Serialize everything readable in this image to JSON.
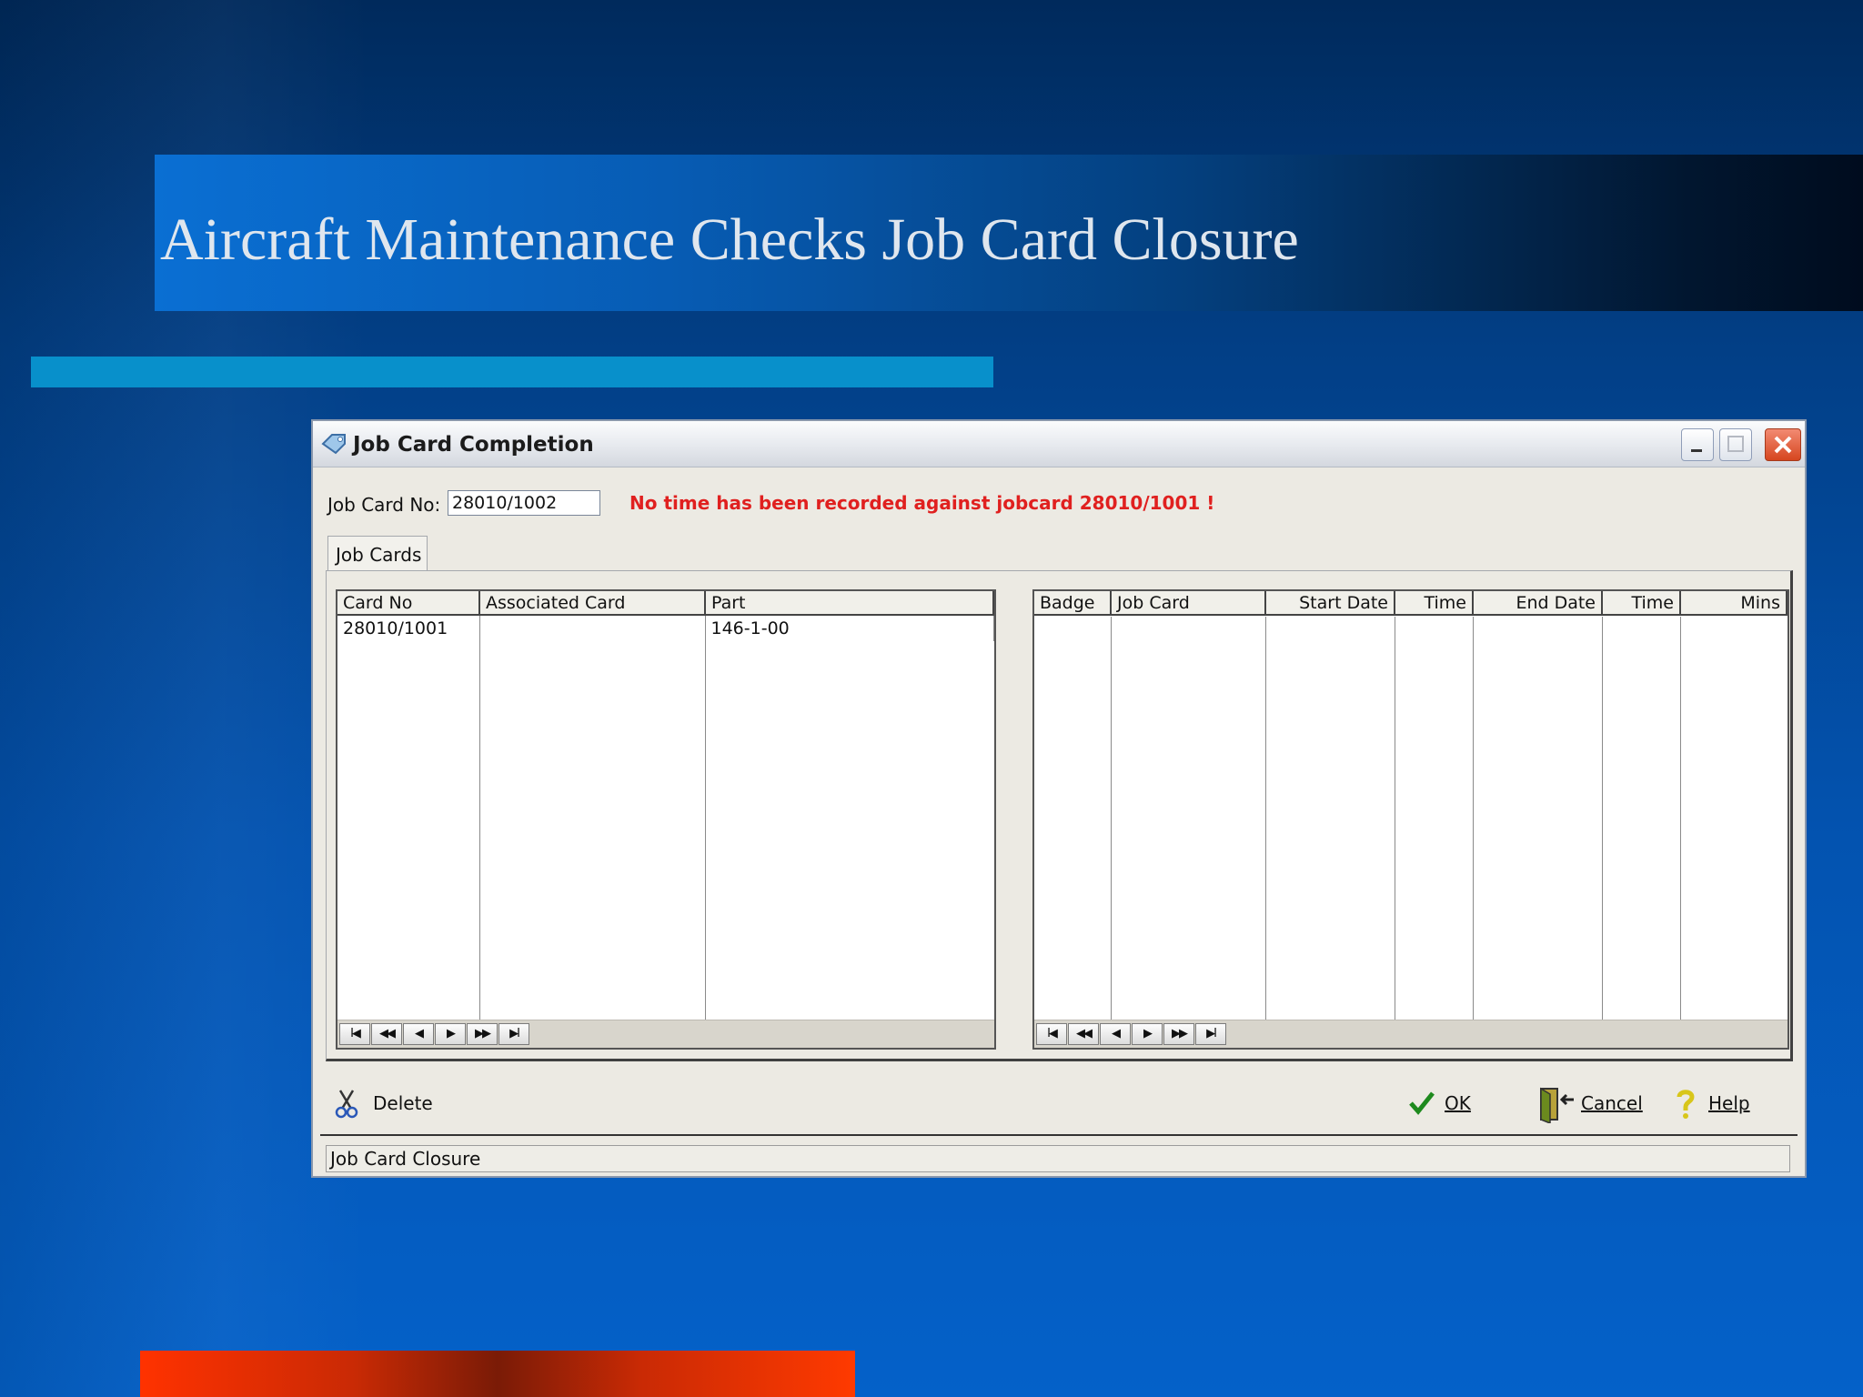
{
  "slide": {
    "title": "Aircraft Maintenance Checks Job Card Closure"
  },
  "window": {
    "title": "Job Card Completion"
  },
  "form": {
    "job_card_label": "Job Card No:",
    "job_card_value": "28010/1002",
    "message": "No time has been recorded against jobcard 28010/1001 !"
  },
  "tabs": [
    {
      "label": "Job Cards"
    }
  ],
  "left_grid": {
    "columns": [
      "Card No",
      "Associated Card",
      "Part"
    ],
    "rows": [
      [
        "28010/1001",
        "",
        "146-1-00"
      ]
    ]
  },
  "right_grid": {
    "columns": [
      "Badge",
      "Job Card",
      "Start Date",
      "Time",
      "End Date",
      "Time",
      "Mins"
    ],
    "rows": []
  },
  "nav_buttons": [
    "I◀",
    "◀◀",
    "◀",
    "▶",
    "▶▶",
    "▶I"
  ],
  "actions": {
    "delete": "Delete",
    "ok": "OK",
    "cancel": "Cancel",
    "help": "Help"
  },
  "status": "Job Card Closure",
  "colors": {
    "message": "#e0201f",
    "accent_bar": "#0890cb",
    "bottom_bar": "#ff3200"
  }
}
